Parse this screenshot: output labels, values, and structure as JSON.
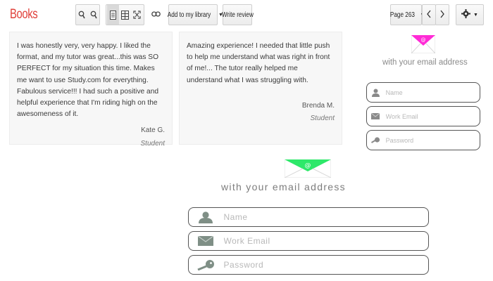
{
  "toolbar": {
    "brand": "Books",
    "zoom_in_icon": "zoom-in-icon",
    "zoom_out_icon": "zoom-out-icon",
    "add_to_library_label": "Add to my library",
    "write_review_label": "Write review",
    "page_label": "Page 263",
    "prev_icon": "chevron-left-icon",
    "next_icon": "chevron-right-icon",
    "settings_icon": "gear-icon"
  },
  "testimonials": [
    {
      "quote": "I was honestly very, very happy. I liked the format, and my tutor was great...this was SO PERFECT for my situation this time. Makes me want to use Study.com for everything. Fabulous service!!! I had such a positive and helpful experience that I'm riding high on the awesomeness of it.",
      "name": "Kate G.",
      "role": "Student"
    },
    {
      "quote": "Amazing experience! I needed that little push to help me understand what was right in front of me!... The tutor really helped me understand what I was struggling with.",
      "name": "Brenda M.",
      "role": "Student"
    }
  ],
  "signup_small": {
    "tagline": "with your email address",
    "envelope_color": "#ff2bd6",
    "name_placeholder": "Name",
    "email_placeholder": "Work Email",
    "password_placeholder": "Password"
  },
  "signup_large": {
    "tagline": "with your email address",
    "envelope_color": "#2ee86a",
    "name_placeholder": "Name",
    "email_placeholder": "Work Email",
    "password_placeholder": "Password"
  },
  "colors": {
    "brand": "#e0403a"
  }
}
